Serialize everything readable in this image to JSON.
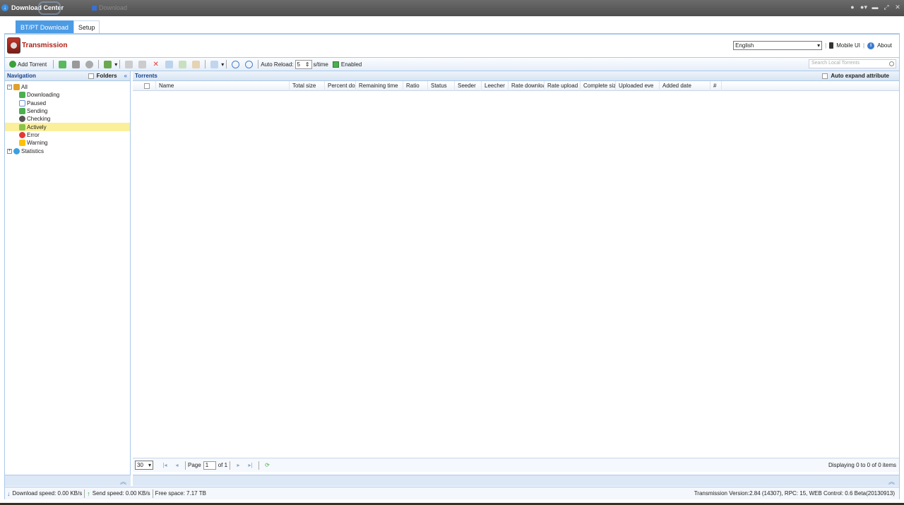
{
  "window": {
    "title": "Download Center",
    "second_tab": "Download"
  },
  "tabs": [
    {
      "label": "BT/PT Download"
    },
    {
      "label": "Setup"
    }
  ],
  "header": {
    "brand": "Transmission",
    "language": "English",
    "mobile_ui": "Mobile UI",
    "about": "About"
  },
  "toolbar": {
    "add_torrent": "Add Torrent",
    "auto_reload_label": "Auto Reload:",
    "auto_reload_value": "5",
    "auto_reload_unit": "s/time",
    "enabled": "Enabled",
    "search_placeholder": "Search Local Torrents"
  },
  "navigation": {
    "title": "Navigation",
    "folders": "Folders",
    "items": [
      {
        "label": "All",
        "icon": "home-icon",
        "color": "#e0a030"
      },
      {
        "label": "Downloading",
        "icon": "download-arrow-icon",
        "color": "#4caf50"
      },
      {
        "label": "Paused",
        "icon": "pause-icon",
        "color": "#6a8fd0"
      },
      {
        "label": "Sending",
        "icon": "upload-arrow-icon",
        "color": "#4caf50"
      },
      {
        "label": "Checking",
        "icon": "checking-icon",
        "color": "#555555"
      },
      {
        "label": "Actively",
        "icon": "active-icon",
        "color": "#8bc34a"
      },
      {
        "label": "Error",
        "icon": "error-icon",
        "color": "#e53935"
      },
      {
        "label": "Warning",
        "icon": "warning-icon",
        "color": "#ffc107"
      },
      {
        "label": "Statistics",
        "icon": "statistics-icon",
        "color": "#3aa0e0"
      }
    ]
  },
  "torrents": {
    "title": "Torrents",
    "auto_expand": "Auto expand attribute",
    "columns": [
      "Name",
      "Total size",
      "Percent dor",
      "Remaining time",
      "Ratio",
      "Status",
      "Seeder",
      "Leecher",
      "Rate downloa",
      "Rate upload",
      "Complete siz",
      "Uploaded eve",
      "Added date",
      "#"
    ]
  },
  "pager": {
    "page_size": "30",
    "page_label": "Page",
    "page_value": "1",
    "of_label": "of 1",
    "display": "Displaying 0 to 0 of 0 items"
  },
  "status": {
    "download_speed": "Download speed: 0.00 KB/s",
    "send_speed": "Send speed: 0.00 KB/s",
    "free_space": "Free space: 7.17 TB",
    "version": "Transmission Version:2.84 (14307), RPC: 15, WEB Control: 0.6 Beta(20130913)"
  }
}
